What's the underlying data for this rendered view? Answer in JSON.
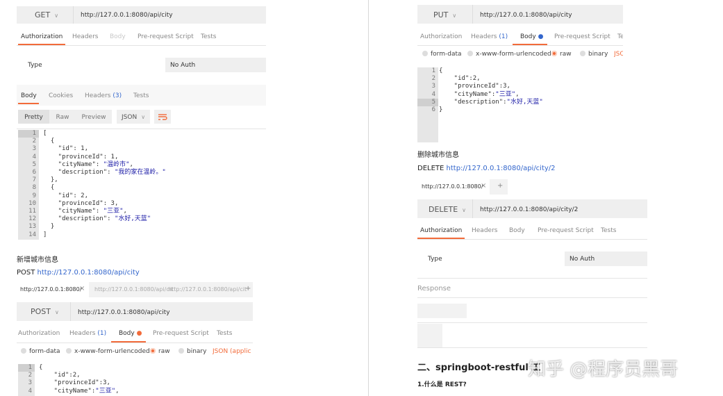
{
  "get": {
    "method": "GET",
    "url": "http://127.0.0.1:8080/api/city",
    "tabs": [
      "Authorization",
      "Headers",
      "Body",
      "Pre-request Script",
      "Tests"
    ],
    "auth_label": "Type",
    "auth_value": "No Auth",
    "resp_tabs": {
      "body": "Body",
      "cookies": "Cookies",
      "headers": "Headers",
      "headers_count": "(3)",
      "tests": "Tests"
    },
    "view": {
      "pretty": "Pretty",
      "raw": "Raw",
      "preview": "Preview",
      "format": "JSON"
    },
    "line_numbers": [
      "1",
      "2",
      "3",
      "4",
      "5",
      "6",
      "7",
      "8",
      "9",
      "10",
      "11",
      "12",
      "13",
      "14"
    ],
    "code_lines": [
      "[",
      "  {",
      "    \"id\": 1,",
      "    \"provinceId\": 1,",
      "    \"cityName\": \"温岭市\",",
      "    \"description\": \"我的家在温岭。\"",
      "  },",
      "  {",
      "    \"id\": 2,",
      "    \"provinceId\": 3,",
      "    \"cityName\": \"三亚\",",
      "    \"description\": \"水好,天蓝\"",
      "  }",
      "]"
    ]
  },
  "post_section": {
    "heading": "新增城市信息",
    "label": "POST",
    "link": "http://127.0.0.1:8080/api/city",
    "tab_strip": [
      "http://127.0.0.1:8080/",
      "http://127.0.0.1:8080/api/cit",
      "http://127.0.0.1:8080/api/cit"
    ],
    "close": "×",
    "plus": "+",
    "method": "POST",
    "url": "http://127.0.0.1:8080/api/city",
    "tabs": [
      "Authorization",
      "Headers",
      "(1)",
      "Body",
      "Pre-request Script",
      "Tests"
    ],
    "body_opts": [
      "form-data",
      "x-www-form-urlencoded",
      "raw",
      "binary",
      "JSON (applicat"
    ],
    "line_numbers": [
      "1",
      "2",
      "3",
      "4"
    ],
    "code_lines": [
      "{",
      "    \"id\":2,",
      "    \"provinceId\":3,",
      "    \"cityName\":\"三亚\","
    ]
  },
  "put": {
    "method": "PUT",
    "url": "http://127.0.0.1:8080/api/city",
    "tabs": [
      "Authorization",
      "Headers",
      "(1)",
      "Body",
      "Pre-request Script",
      "Te"
    ],
    "body_opts": [
      "form-data",
      "x-www-form-urlencoded",
      "raw",
      "binary",
      "JSO"
    ],
    "line_numbers": [
      "1",
      "2",
      "3",
      "4",
      "5",
      "6"
    ],
    "code_lines": [
      "{",
      "    \"id\":2,",
      "    \"provinceId\":3,",
      "    \"cityName\":\"三亚\",",
      "    \"description\":\"水好,天蓝\"",
      "}"
    ]
  },
  "delete_section": {
    "heading": "删除城市信息",
    "label": "DELETE",
    "link": "http://127.0.0.1:8080/api/city/2",
    "tab": "http://127.0.0.1:8080/",
    "close": "×",
    "plus": "+",
    "method": "DELETE",
    "url": "http://127.0.0.1:8080/api/city/2",
    "tabs": [
      "Authorization",
      "Headers",
      "Body",
      "Pre-request Script",
      "Tests"
    ],
    "auth_label": "Type",
    "auth_value": "No Auth",
    "response": "Response"
  },
  "section2": {
    "heading": "二、springboot-restful 工",
    "sub": "1.什么是 REST?"
  },
  "watermark": "知乎 @程序员黑哥",
  "colors": {
    "accent": "#f26b3a",
    "link": "#3366cc",
    "string": "#1a1aa6"
  }
}
